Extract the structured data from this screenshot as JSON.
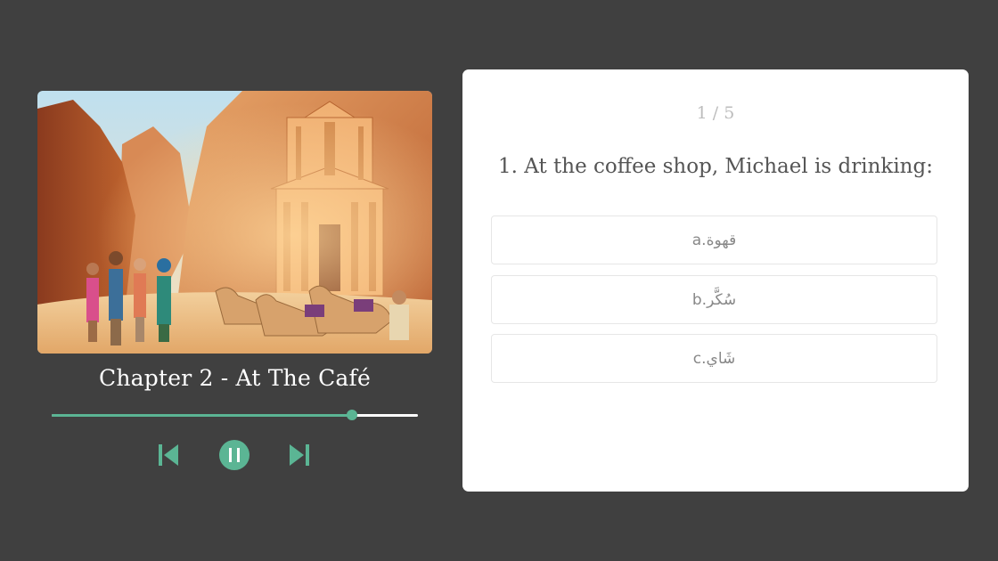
{
  "player": {
    "chapter_title": "Chapter 2 - At The Café",
    "progress": 0.82,
    "accent_color": "#5bb594",
    "controls": {
      "prev_icon": "skip-previous-icon",
      "pause_icon": "pause-icon",
      "next_icon": "skip-next-icon"
    }
  },
  "quiz": {
    "counter": "1 / 5",
    "question": "1. At the coffee shop, Michael is drinking:",
    "options": [
      {
        "label": "a.قهوة"
      },
      {
        "label": "b.سُكَّر"
      },
      {
        "label": "c.شَاي"
      }
    ]
  }
}
